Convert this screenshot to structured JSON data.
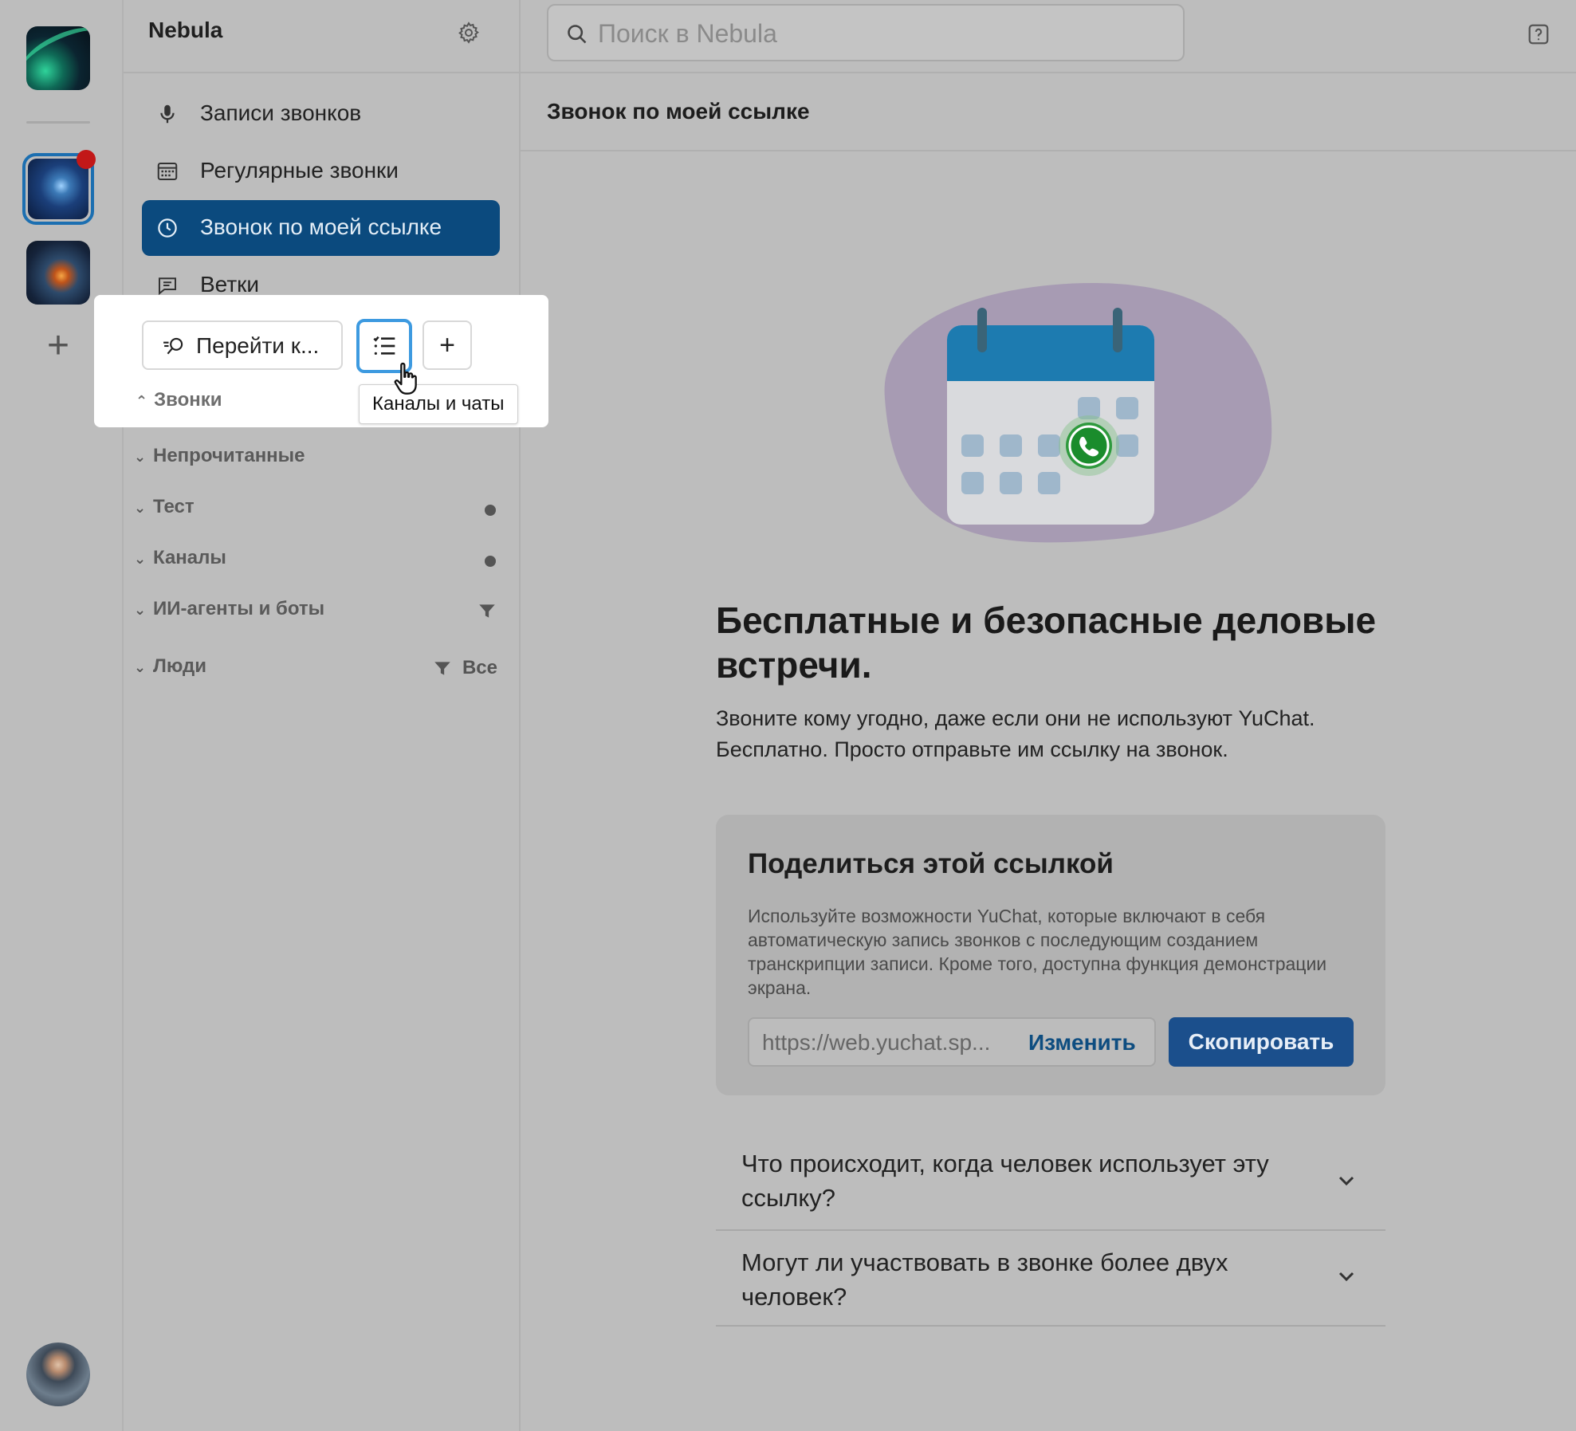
{
  "workspace": {
    "name": "Nebula"
  },
  "sidebar": {
    "nav": [
      {
        "label": "Записи звонков",
        "icon": "microphone-icon"
      },
      {
        "label": "Регулярные звонки",
        "icon": "calendar-icon"
      },
      {
        "label": "Звонок по моей ссылке",
        "icon": "clock-icon",
        "active": true
      },
      {
        "label": "Ветки",
        "icon": "threads-icon"
      }
    ],
    "toolbar": {
      "goto_label": "Перейти к...",
      "list_tooltip": "Каналы и чаты",
      "plus_label": "+"
    },
    "sections": [
      {
        "label": "Звонки",
        "expanded": true
      },
      {
        "label": "Непрочитанные"
      },
      {
        "label": "Тест",
        "dot": true
      },
      {
        "label": "Каналы",
        "dot": true
      },
      {
        "label": "ИИ-агенты и боты",
        "filter": true
      },
      {
        "label": "Люди",
        "filter": true,
        "filter_label": "Все"
      }
    ]
  },
  "search": {
    "placeholder": "Поиск в Nebula"
  },
  "page": {
    "title": "Звонок по моей ссылке",
    "headline": "Бесплатные и безопасные деловые встречи.",
    "subtext": "Звоните кому угодно, даже если они не используют YuChat. Бесплатно. Просто отправьте им ссылку на звонок."
  },
  "share": {
    "title": "Поделиться этой ссылкой",
    "description": "Используйте возможности YuChat, которые включают в себя автоматическую запись звонков с последующим созданием транскрипции записи. Кроме того, доступна функция демонстрации экрана.",
    "link_value": "https://web.yuchat.sp...",
    "edit_label": "Изменить",
    "copy_label": "Скопировать"
  },
  "faq": [
    {
      "question": "Что происходит, когда человек использует эту ссылку?"
    },
    {
      "question": "Могут ли участвовать в звонке более двух человек?"
    }
  ],
  "colors": {
    "accent": "#0b4a7e",
    "copy_button": "#1b4f8c",
    "focus_ring": "#3d9ae0",
    "notification_badge": "#c21818"
  }
}
